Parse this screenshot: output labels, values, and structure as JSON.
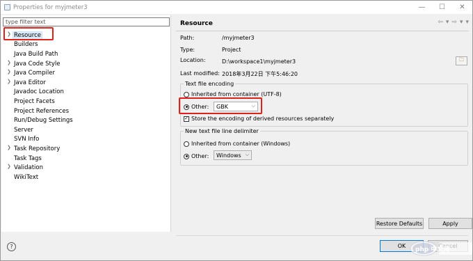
{
  "window": {
    "title": "Properties for myjmeter3",
    "controls": {
      "minimize": "—",
      "maximize": "☐",
      "close": "✕"
    }
  },
  "filter": {
    "placeholder": "type filter text",
    "value": ""
  },
  "tree": {
    "items": [
      {
        "label": "Resource",
        "expandable": true,
        "selected": true
      },
      {
        "label": "Builders",
        "expandable": false
      },
      {
        "label": "Java Build Path",
        "expandable": false
      },
      {
        "label": "Java Code Style",
        "expandable": true
      },
      {
        "label": "Java Compiler",
        "expandable": true
      },
      {
        "label": "Java Editor",
        "expandable": true
      },
      {
        "label": "Javadoc Location",
        "expandable": false
      },
      {
        "label": "Project Facets",
        "expandable": false
      },
      {
        "label": "Project References",
        "expandable": false
      },
      {
        "label": "Run/Debug Settings",
        "expandable": false
      },
      {
        "label": "Server",
        "expandable": false
      },
      {
        "label": "SVN Info",
        "expandable": false
      },
      {
        "label": "Task Repository",
        "expandable": true
      },
      {
        "label": "Task Tags",
        "expandable": false
      },
      {
        "label": "Validation",
        "expandable": true
      },
      {
        "label": "WikiText",
        "expandable": false
      }
    ]
  },
  "page": {
    "title": "Resource",
    "nav": {
      "back": "⇦",
      "back_menu": "▾",
      "forward": "⇨",
      "forward_menu": "▾",
      "view_menu": "▾"
    },
    "props": {
      "path_label": "Path:",
      "path_value": "/myjmeter3",
      "type_label": "Type:",
      "type_value": "Project",
      "location_label": "Location:",
      "location_value": "D:\\workspace1\\myjmeter3",
      "modified_label": "Last modified:",
      "modified_value": "2018年3月22日 下午5:46:20"
    },
    "browse_icon": "folder-icon",
    "encoding": {
      "legend": "Text file encoding",
      "inherited_label": "Inherited from container (UTF-8)",
      "other_label": "Other:",
      "other_value": "GBK",
      "store_label": "Store the encoding of derived resources separately",
      "store_checked": true
    },
    "delimiter": {
      "legend": "New text file line delimiter",
      "inherited_label": "Inherited from container (Windows)",
      "other_label": "Other:",
      "other_value": "Windows"
    },
    "buttons": {
      "restore_defaults": "Restore Defaults",
      "apply": "Apply"
    }
  },
  "footer": {
    "help": "?",
    "ok": "OK",
    "cancel": "Cancel"
  },
  "watermark": "php 中文网",
  "colors": {
    "highlight_box": "#e0211a",
    "selection": "#d9ebf9",
    "default_button_border": "#0078d7"
  }
}
